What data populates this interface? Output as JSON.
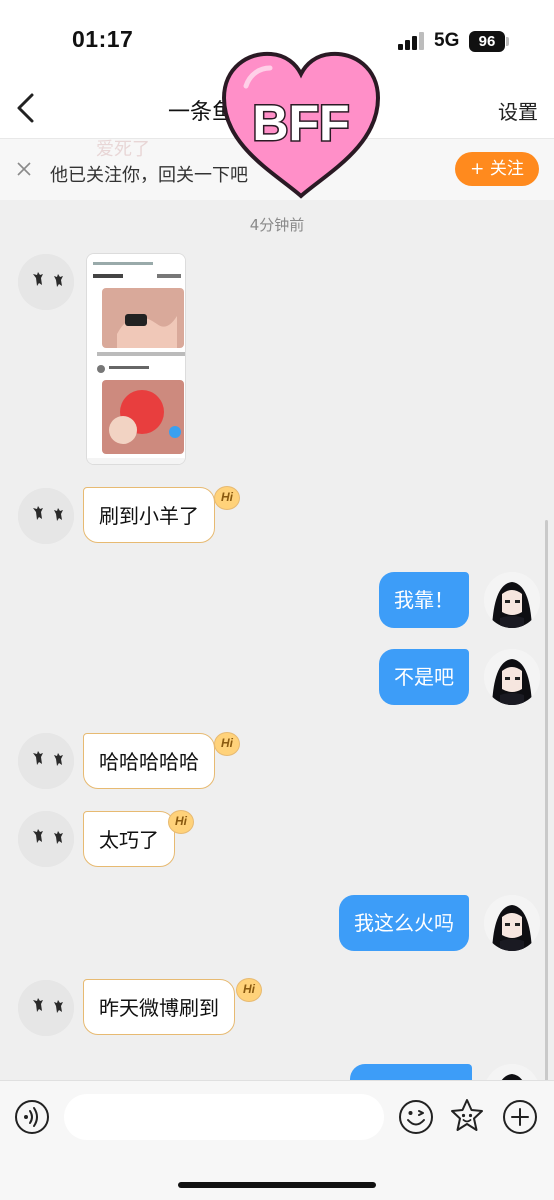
{
  "status_bar": {
    "time": "01:17",
    "network": "5G",
    "battery": "96"
  },
  "header": {
    "title": "一条鱼",
    "settings_label": "设置"
  },
  "sticker": {
    "text": "BFF",
    "colors": {
      "heart": "#ff8fc8",
      "outline": "#2a1a24"
    }
  },
  "banner": {
    "ghost_text": "爱死了",
    "text": "他已关注你，回关一下吧",
    "follow_label": "+ 关注"
  },
  "chat": {
    "timestamp": "4分钟前",
    "messages": [
      {
        "side": "left",
        "type": "image"
      },
      {
        "side": "left",
        "type": "text",
        "text": "刷到小羊了",
        "badge": "Hi"
      },
      {
        "side": "right",
        "type": "text",
        "text": "我靠！"
      },
      {
        "side": "right",
        "type": "text",
        "text": "不是吧"
      },
      {
        "side": "left",
        "type": "text",
        "text": "哈哈哈哈哈",
        "badge": "Hi"
      },
      {
        "side": "left",
        "type": "text",
        "text": "太巧了",
        "badge": "Hi"
      },
      {
        "side": "right",
        "type": "text",
        "text": "我这么火吗"
      },
      {
        "side": "left",
        "type": "text",
        "text": "昨天微博刷到",
        "badge": "Hi"
      },
      {
        "side": "right",
        "type": "text",
        "text": ""
      }
    ]
  },
  "input": {
    "placeholder": "",
    "value": ""
  },
  "colors": {
    "accent_orange": "#ff8a1e",
    "bubble_blue": "#3d9df8",
    "bubble_border": "#e7ba72",
    "background": "#efefef"
  },
  "icons": {
    "back": "chevron-left-icon",
    "voice": "voice-icon",
    "emoji": "smiley-icon",
    "sticker": "sticker-icon",
    "plus": "plus-circle-icon",
    "close": "close-icon"
  }
}
